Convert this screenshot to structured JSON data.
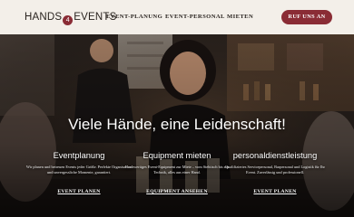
{
  "header": {
    "logo": {
      "left": "HANDS",
      "heart": "4",
      "right": "EVENTS"
    },
    "nav": [
      "EVENT-PLANUNG",
      "EVENT-PERSONAL",
      "MIETEN"
    ],
    "cta": "RUF UNS AN"
  },
  "hero": {
    "headline": "Viele Hände, eine Leidenschaft!",
    "columns": [
      {
        "title": "Eventplanung",
        "text": "Wir planen und betreuen Events jeder Größe. Perfekte Organisation und unvergessliche Momente, garantiert.",
        "link": "EVENT PLANEN"
      },
      {
        "title": "Equipment mieten",
        "text": "Hochwertiges Event-Equipment zur Miete – vom Stehtisch bis zur Technik, alles aus einer Hand.",
        "link": "EQUIPMENT ANSEHEN"
      },
      {
        "title": "personaldienstleistung",
        "text": "Qualifiziertes Servicepersonal, Barpersonal und Logistik für Ihr Event. Zuverlässig und professionell.",
        "link": "EVENT PLANEN"
      }
    ]
  },
  "colors": {
    "header_bg": "#f3efe9",
    "accent": "#8a2c35",
    "hero_text": "#ffffff"
  }
}
